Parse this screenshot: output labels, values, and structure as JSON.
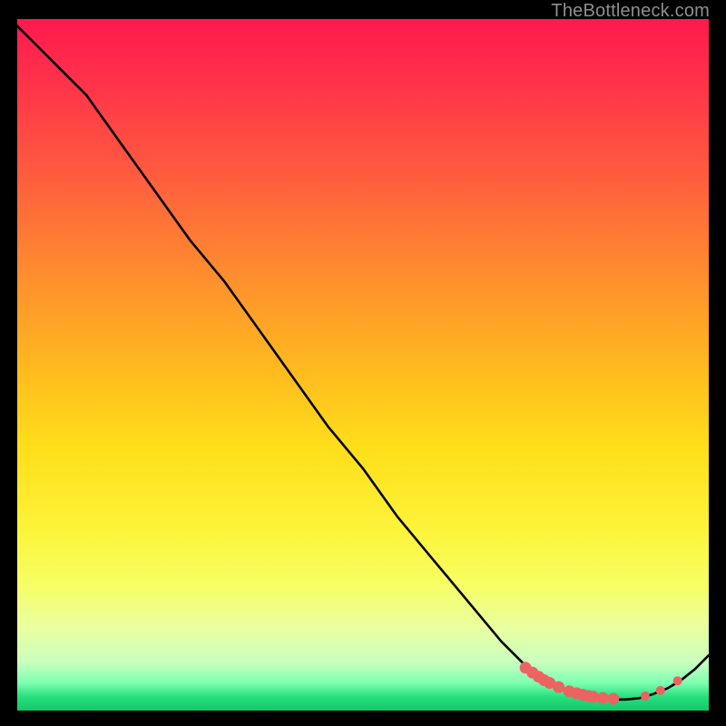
{
  "watermark": "TheBottleneck.com",
  "colors": {
    "dot": "#ed6262",
    "curve": "#000000"
  },
  "chart_data": {
    "type": "line",
    "title": "",
    "xlabel": "",
    "ylabel": "",
    "xlim": [
      0,
      100
    ],
    "ylim": [
      0,
      100
    ],
    "grid": false,
    "legend": false,
    "x": [
      0,
      3,
      6,
      10,
      15,
      20,
      25,
      30,
      35,
      40,
      45,
      50,
      55,
      60,
      65,
      70,
      73,
      75,
      78,
      80,
      82,
      84,
      86,
      88,
      90,
      92,
      94,
      96,
      98,
      100
    ],
    "y": [
      99,
      96,
      93,
      89,
      82,
      75,
      68,
      62,
      55,
      48,
      41,
      35,
      28,
      22,
      16,
      10,
      7,
      5,
      3.5,
      2.5,
      2.0,
      1.8,
      1.6,
      1.6,
      1.8,
      2.4,
      3.2,
      4.4,
      6.0,
      8.0
    ],
    "marker_x": [
      73.5,
      74.5,
      75.4,
      76.2,
      77.0,
      78.3,
      79.8,
      80.9,
      81.8,
      82.6,
      83.3,
      84.7,
      86.2,
      90.8,
      93.0,
      95.5
    ],
    "marker_y": [
      6.2,
      5.5,
      4.9,
      4.4,
      4.0,
      3.4,
      2.8,
      2.5,
      2.3,
      2.1,
      2.0,
      1.8,
      1.7,
      2.1,
      2.9,
      4.3
    ],
    "marker_r": [
      6.5,
      6.5,
      6.5,
      6.5,
      6.5,
      6.5,
      6.5,
      6.5,
      6.5,
      6.5,
      6.5,
      6.5,
      6.5,
      5.0,
      5.0,
      5.0
    ]
  }
}
